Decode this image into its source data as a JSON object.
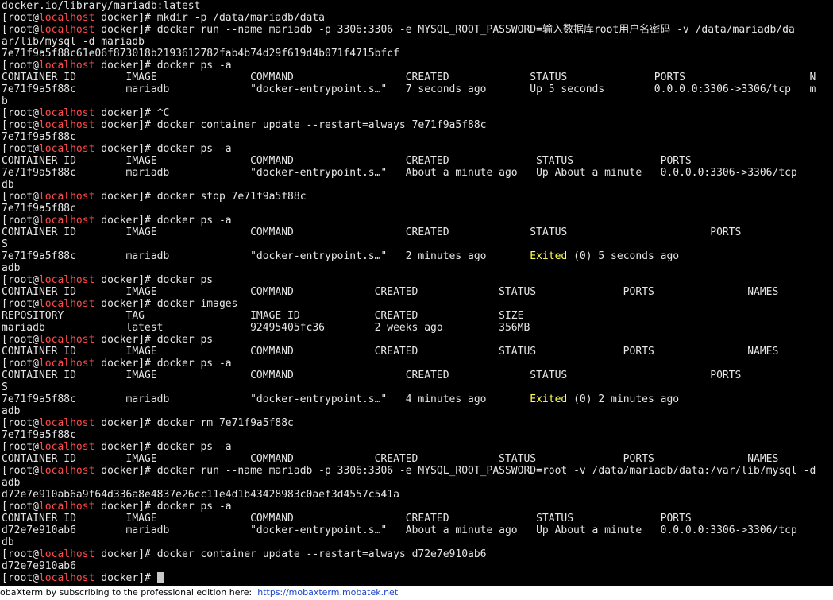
{
  "terminal": {
    "lines": [
      [
        "docker.io/library/mariadb:latest"
      ],
      [
        [
          "[root@",
          ""
        ],
        [
          "localhost",
          "host"
        ],
        [
          " docker]# mkdir -p /data/mariadb/data",
          ""
        ]
      ],
      [
        [
          "[root@",
          ""
        ],
        [
          "localhost",
          "host"
        ],
        [
          " docker]# docker run --name mariadb -p 3306:3306 -e MYSQL_ROOT_PASSWORD=输入数据库root用户名密码 -v /data/mariadb/da",
          ""
        ]
      ],
      [
        "ar/lib/mysql -d mariadb"
      ],
      [
        "7e71f9a5f88c61e06f873018b2193612782fab4b74d29f619d4b071f4715bfcf"
      ],
      [
        [
          "[root@",
          ""
        ],
        [
          "localhost",
          "host"
        ],
        [
          " docker]# docker ps -a",
          ""
        ]
      ],
      [
        "CONTAINER ID        IMAGE               COMMAND                  CREATED             STATUS              PORTS                    N"
      ],
      [
        "7e71f9a5f88c        mariadb             \"docker-entrypoint.s…\"   7 seconds ago       Up 5 seconds        0.0.0.0:3306->3306/tcp   m"
      ],
      [
        "b"
      ],
      [
        [
          "[root@",
          ""
        ],
        [
          "localhost",
          "host"
        ],
        [
          " docker]# ^C",
          ""
        ]
      ],
      [
        [
          "[root@",
          ""
        ],
        [
          "localhost",
          "host"
        ],
        [
          " docker]# docker container update --restart=always 7e71f9a5f88c",
          ""
        ]
      ],
      [
        "7e71f9a5f88c"
      ],
      [
        [
          "[root@",
          ""
        ],
        [
          "localhost",
          "host"
        ],
        [
          " docker]# docker ps -a",
          ""
        ]
      ],
      [
        "CONTAINER ID        IMAGE               COMMAND                  CREATED              STATUS              PORTS"
      ],
      [
        "7e71f9a5f88c        mariadb             \"docker-entrypoint.s…\"   About a minute ago   Up About a minute   0.0.0.0:3306->3306/tcp"
      ],
      [
        "db"
      ],
      [
        [
          "[root@",
          ""
        ],
        [
          "localhost",
          "host"
        ],
        [
          " docker]# docker stop 7e71f9a5f88c",
          ""
        ]
      ],
      [
        "7e71f9a5f88c"
      ],
      [
        [
          "[root@",
          ""
        ],
        [
          "localhost",
          "host"
        ],
        [
          " docker]# docker ps -a",
          ""
        ]
      ],
      [
        "CONTAINER ID        IMAGE               COMMAND                  CREATED             STATUS                       PORTS"
      ],
      [
        "S"
      ],
      [
        [
          "7e71f9a5f88c        mariadb             \"docker-entrypoint.s…\"   2 minutes ago       ",
          ""
        ],
        [
          "Exited",
          "exited"
        ],
        [
          " (0) 5 seconds ago",
          ""
        ]
      ],
      [
        "adb"
      ],
      [
        [
          "[root@",
          ""
        ],
        [
          "localhost",
          "host"
        ],
        [
          " docker]# docker ps",
          ""
        ]
      ],
      [
        "CONTAINER ID        IMAGE               COMMAND             CREATED             STATUS              PORTS               NAMES"
      ],
      [
        [
          "[root@",
          ""
        ],
        [
          "localhost",
          "host"
        ],
        [
          " docker]# docker images",
          ""
        ]
      ],
      [
        "REPOSITORY          TAG                 IMAGE ID            CREATED             SIZE"
      ],
      [
        "mariadb             latest              92495405fc36        2 weeks ago         356MB"
      ],
      [
        [
          "[root@",
          ""
        ],
        [
          "localhost",
          "host"
        ],
        [
          " docker]# docker ps",
          ""
        ]
      ],
      [
        "CONTAINER ID        IMAGE               COMMAND             CREATED             STATUS              PORTS               NAMES"
      ],
      [
        [
          "[root@",
          ""
        ],
        [
          "localhost",
          "host"
        ],
        [
          " docker]# docker ps -a",
          ""
        ]
      ],
      [
        "CONTAINER ID        IMAGE               COMMAND                  CREATED             STATUS                       PORTS"
      ],
      [
        "S"
      ],
      [
        [
          "7e71f9a5f88c        mariadb             \"docker-entrypoint.s…\"   4 minutes ago       ",
          ""
        ],
        [
          "Exited",
          "exited"
        ],
        [
          " (0) 2 minutes ago",
          ""
        ]
      ],
      [
        "adb"
      ],
      [
        [
          "[root@",
          ""
        ],
        [
          "localhost",
          "host"
        ],
        [
          " docker]# docker rm 7e71f9a5f88c",
          ""
        ]
      ],
      [
        "7e71f9a5f88c"
      ],
      [
        [
          "[root@",
          ""
        ],
        [
          "localhost",
          "host"
        ],
        [
          " docker]# docker ps -a",
          ""
        ]
      ],
      [
        "CONTAINER ID        IMAGE               COMMAND             CREATED             STATUS              PORTS               NAMES"
      ],
      [
        [
          "[root@",
          ""
        ],
        [
          "localhost",
          "host"
        ],
        [
          " docker]# docker run --name mariadb -p 3306:3306 -e MYSQL_ROOT_PASSWORD=root -v /data/mariadb/data:/var/lib/mysql -d",
          ""
        ]
      ],
      [
        "adb"
      ],
      [
        "d72e7e910ab6a9f64d336a8e4837e26cc11e4d1b43428983c0aef3d4557c541a"
      ],
      [
        [
          "[root@",
          ""
        ],
        [
          "localhost",
          "host"
        ],
        [
          " docker]# docker ps -a",
          ""
        ]
      ],
      [
        "CONTAINER ID        IMAGE               COMMAND                  CREATED              STATUS              PORTS"
      ],
      [
        "d72e7e910ab6        mariadb             \"docker-entrypoint.s…\"   About a minute ago   Up About a minute   0.0.0.0:3306->3306/tcp"
      ],
      [
        "db"
      ],
      [
        [
          "[root@",
          ""
        ],
        [
          "localhost",
          "host"
        ],
        [
          " docker]# docker container update --restart=always d72e7e910ab6",
          ""
        ]
      ],
      [
        "d72e7e910ab6"
      ],
      [
        [
          "[root@",
          ""
        ],
        [
          "localhost",
          "host"
        ],
        [
          " docker]# ",
          ""
        ]
      ]
    ]
  },
  "statusbar": {
    "text": "obaXterm by subscribing to the professional edition here:  ",
    "link": "https://mobaxterm.mobatek.net"
  },
  "colors": {
    "background": "#000000",
    "foreground": "#e6e6e6",
    "hostname": "#ff4a4a",
    "exited": "#ffff55",
    "link": "#1a45c8"
  }
}
